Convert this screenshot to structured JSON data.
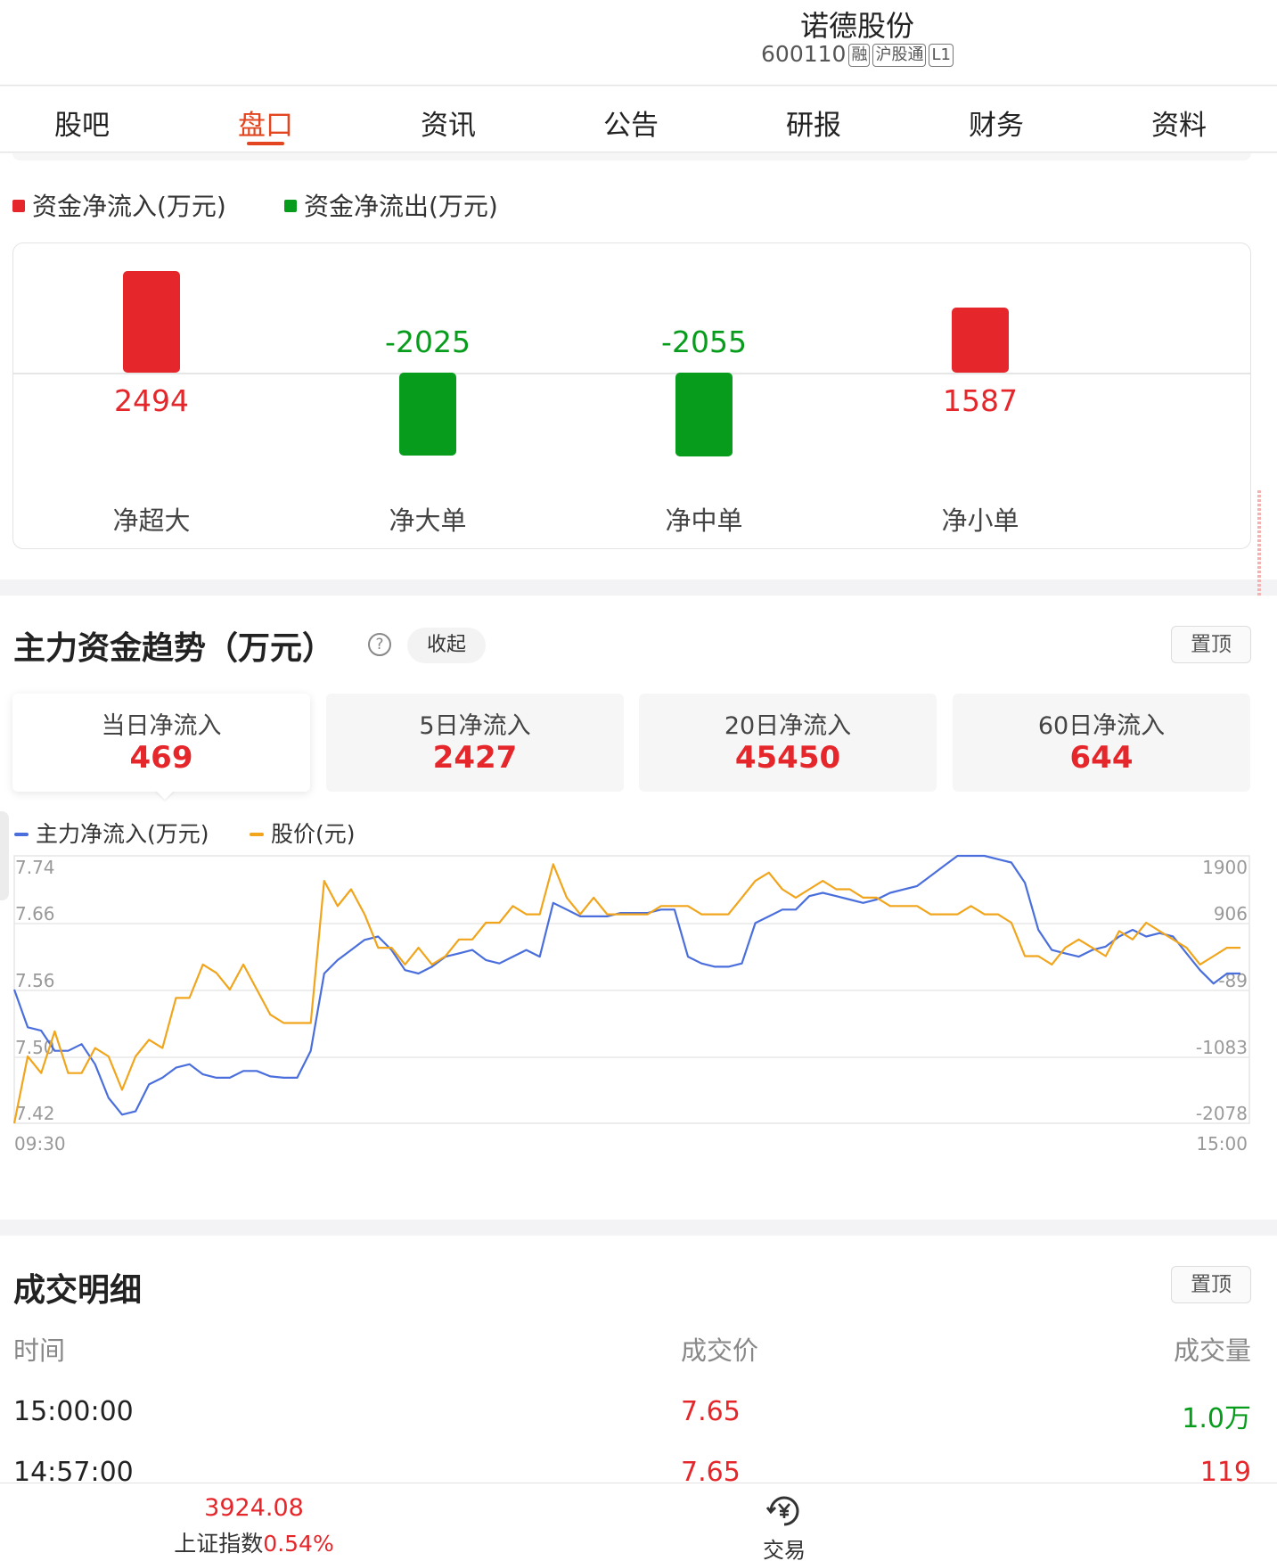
{
  "header": {
    "stock_name": "诺德股份",
    "stock_code": "600110",
    "tags": [
      "融",
      "沪股通",
      "L1"
    ]
  },
  "tabs": [
    {
      "label": "股吧",
      "active": false
    },
    {
      "label": "盘口",
      "active": true
    },
    {
      "label": "资讯",
      "active": false
    },
    {
      "label": "公告",
      "active": false
    },
    {
      "label": "研报",
      "active": false
    },
    {
      "label": "财务",
      "active": false
    },
    {
      "label": "资料",
      "active": false
    }
  ],
  "colors": {
    "accent": "#e2451f",
    "up": "#e5262a",
    "down": "#089c1d",
    "line_main": "#4a6fdc",
    "line_price": "#f0a51c"
  },
  "fund_flow": {
    "legend_inflow": "资金净流入(万元)",
    "legend_outflow": "资金净流出(万元)",
    "items": [
      {
        "label": "净超大",
        "value": "2494",
        "num": 2494
      },
      {
        "label": "净大单",
        "value": "-2025",
        "num": -2025
      },
      {
        "label": "净中单",
        "value": "-2055",
        "num": -2055
      },
      {
        "label": "净小单",
        "value": "1587",
        "num": 1587
      }
    ]
  },
  "trend": {
    "title": "主力资金趋势（万元）",
    "help_icon": "question-circle-icon",
    "collapse_label": "收起",
    "pin_label": "置顶",
    "cards": [
      {
        "label": "当日净流入",
        "value": "469",
        "active": true
      },
      {
        "label": "5日净流入",
        "value": "2427",
        "active": false
      },
      {
        "label": "20日净流入",
        "value": "45450",
        "active": false
      },
      {
        "label": "60日净流入",
        "value": "644",
        "active": false
      }
    ],
    "legend_main": "主力净流入(万元)",
    "legend_price": "股价(元)"
  },
  "chart_data": {
    "type": "line",
    "x_start": "09:30",
    "x_end": "15:00",
    "left_axis": {
      "ticks": [
        "7.74",
        "7.66",
        "7.56",
        "7.50",
        "7.42"
      ],
      "range": [
        7.42,
        7.74
      ]
    },
    "right_axis": {
      "ticks": [
        "1900",
        "906",
        "-89",
        "-1083",
        "-2078"
      ],
      "range": [
        -2078,
        1900
      ]
    },
    "series": [
      {
        "name": "主力净流入(万元)",
        "axis": "right",
        "values": [
          -89,
          -650,
          -700,
          -1000,
          -1000,
          -900,
          -1200,
          -1700,
          -1950,
          -1900,
          -1500,
          -1400,
          -1250,
          -1200,
          -1350,
          -1400,
          -1400,
          -1300,
          -1300,
          -1380,
          -1400,
          -1400,
          -1000,
          150,
          350,
          500,
          650,
          700,
          500,
          200,
          150,
          250,
          400,
          450,
          500,
          350,
          300,
          400,
          500,
          400,
          1200,
          1100,
          1000,
          1000,
          1000,
          1050,
          1050,
          1050,
          1100,
          1100,
          400,
          300,
          250,
          250,
          300,
          900,
          1000,
          1100,
          1100,
          1300,
          1350,
          1300,
          1250,
          1200,
          1250,
          1350,
          1400,
          1450,
          1600,
          1750,
          1900,
          1900,
          1900,
          1850,
          1800,
          1500,
          800,
          500,
          450,
          400,
          500,
          550,
          700,
          800,
          700,
          750,
          700,
          450,
          200,
          0,
          150,
          150
        ]
      },
      {
        "name": "股价(元)",
        "axis": "left",
        "values": [
          7.42,
          7.5,
          7.48,
          7.53,
          7.48,
          7.48,
          7.51,
          7.5,
          7.46,
          7.5,
          7.52,
          7.51,
          7.57,
          7.57,
          7.61,
          7.6,
          7.58,
          7.61,
          7.58,
          7.55,
          7.54,
          7.54,
          7.54,
          7.71,
          7.68,
          7.7,
          7.67,
          7.63,
          7.63,
          7.61,
          7.63,
          7.61,
          7.62,
          7.64,
          7.64,
          7.66,
          7.66,
          7.68,
          7.67,
          7.67,
          7.73,
          7.69,
          7.67,
          7.69,
          7.67,
          7.67,
          7.67,
          7.67,
          7.68,
          7.68,
          7.68,
          7.67,
          7.67,
          7.67,
          7.69,
          7.71,
          7.72,
          7.7,
          7.69,
          7.7,
          7.71,
          7.7,
          7.7,
          7.69,
          7.69,
          7.68,
          7.68,
          7.68,
          7.67,
          7.67,
          7.67,
          7.68,
          7.67,
          7.67,
          7.66,
          7.62,
          7.62,
          7.61,
          7.63,
          7.64,
          7.63,
          7.62,
          7.65,
          7.64,
          7.66,
          7.65,
          7.64,
          7.63,
          7.61,
          7.62,
          7.63,
          7.63
        ]
      }
    ]
  },
  "detail": {
    "title": "成交明细",
    "pin_label": "置顶",
    "headers": {
      "time": "时间",
      "price": "成交价",
      "volume": "成交量"
    },
    "rows": [
      {
        "time": "15:00:00",
        "price": "7.65",
        "volume": "1.0万",
        "volume_color": "green"
      },
      {
        "time": "14:57:00",
        "price": "7.65",
        "volume": "119",
        "volume_color": "red"
      }
    ]
  },
  "bottom_bar": {
    "index_value": "3924.08",
    "index_name": "上证指数",
    "index_change": "0.54%",
    "trade_label": "交易",
    "trade_icon": "yen-circle-icon"
  }
}
